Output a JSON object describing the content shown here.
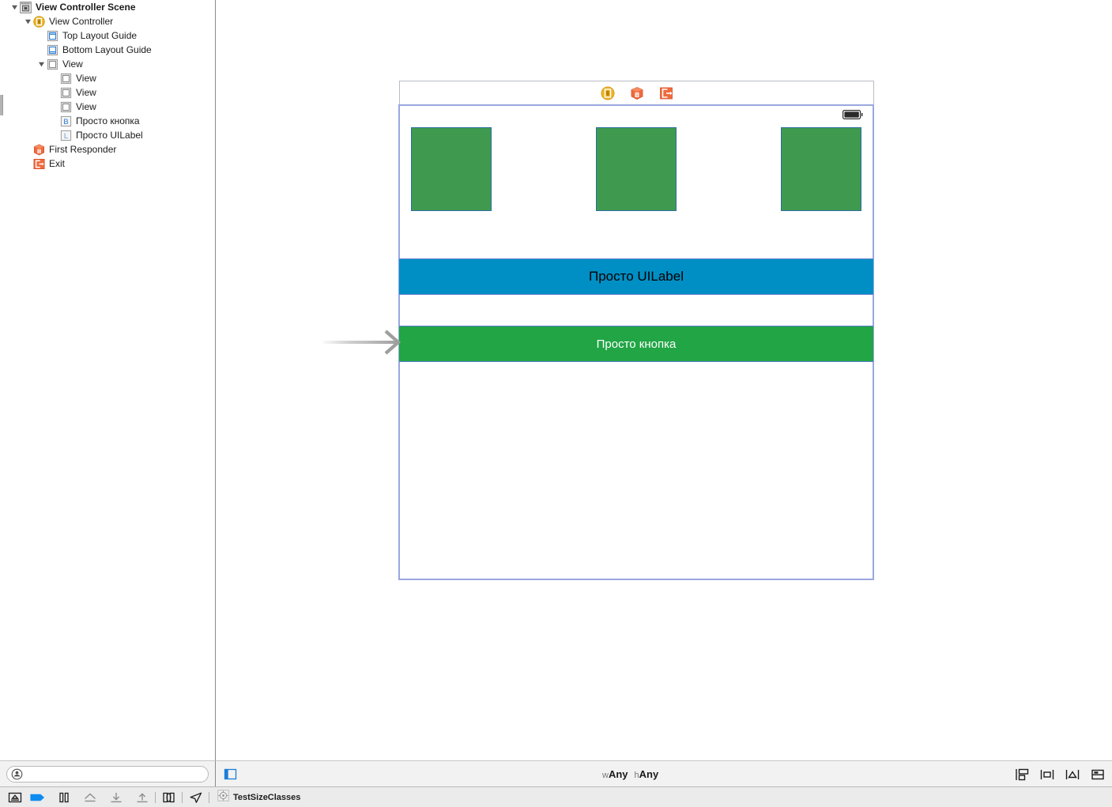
{
  "outline": {
    "panel_name": "Document Outline",
    "filter_placeholder": "",
    "filter_value": "",
    "rows": [
      {
        "label": "View Controller Scene",
        "icon": "scene-icon",
        "depth": 0,
        "expanded": true,
        "bold": true
      },
      {
        "label": "View Controller",
        "icon": "view-controller-icon",
        "depth": 1,
        "expanded": true,
        "bold": false
      },
      {
        "label": "Top Layout Guide",
        "icon": "top-layout-guide-icon",
        "depth": 2,
        "expanded": null,
        "bold": false
      },
      {
        "label": "Bottom Layout Guide",
        "icon": "bottom-layout-guide-icon",
        "depth": 2,
        "expanded": null,
        "bold": false
      },
      {
        "label": "View",
        "icon": "view-icon",
        "depth": 2,
        "expanded": true,
        "bold": false
      },
      {
        "label": "View",
        "icon": "view-icon",
        "depth": 3,
        "expanded": null,
        "bold": false
      },
      {
        "label": "View",
        "icon": "view-icon",
        "depth": 3,
        "expanded": null,
        "bold": false
      },
      {
        "label": "View",
        "icon": "view-icon",
        "depth": 3,
        "expanded": null,
        "bold": false
      },
      {
        "label": "Просто кнопка",
        "icon": "button-icon",
        "depth": 3,
        "expanded": null,
        "bold": false
      },
      {
        "label": "Просто UILabel",
        "icon": "label-icon",
        "depth": 3,
        "expanded": null,
        "bold": false
      },
      {
        "label": "First Responder",
        "icon": "first-responder-icon",
        "depth": 1,
        "expanded": null,
        "bold": false
      },
      {
        "label": "Exit",
        "icon": "exit-icon",
        "depth": 1,
        "expanded": null,
        "bold": false
      }
    ]
  },
  "canvas": {
    "scene_dock": [
      {
        "name": "view-controller-icon",
        "tooltip": "View Controller"
      },
      {
        "name": "first-responder-icon",
        "tooltip": "First Responder"
      },
      {
        "name": "exit-icon",
        "tooltip": "Exit"
      }
    ],
    "status_bar": {
      "battery_icon": "battery-icon"
    },
    "squares": [
      {
        "name": "green-square-1",
        "color": "#3f9a4f"
      },
      {
        "name": "green-square-2",
        "color": "#3f9a4f"
      },
      {
        "name": "green-square-3",
        "color": "#3f9a4f"
      }
    ],
    "label_band": {
      "text": "Просто UILabel",
      "background": "#008fc4",
      "text_color": "#000000"
    },
    "button_band": {
      "text": "Просто кнопка",
      "background": "#21a545",
      "text_color": "#ffffff"
    },
    "selection_border_color": "#9aa7e0"
  },
  "status_bar": {
    "doc_outline_toggle": "document-outline-toggle-icon",
    "size_class": {
      "width_prefix": "w",
      "width_value": "Any",
      "height_prefix": "h",
      "height_value": "Any"
    },
    "autolayout": [
      {
        "name": "stack-button",
        "label": "Stack"
      },
      {
        "name": "align-button",
        "label": "Align"
      },
      {
        "name": "pin-button",
        "label": "Pin"
      },
      {
        "name": "resolve-issues-button",
        "label": "Resolve Auto Layout Issues"
      }
    ]
  },
  "debug_bar": {
    "buttons": [
      {
        "name": "hide-debug-area-button",
        "label": "Hide Debug Area"
      },
      {
        "name": "activate-breakpoints-button",
        "label": "Activate Breakpoints"
      },
      {
        "name": "pause-button",
        "label": "Pause"
      },
      {
        "name": "step-over-button",
        "label": "Step Over"
      },
      {
        "name": "step-into-button",
        "label": "Step Into"
      },
      {
        "name": "step-out-button",
        "label": "Step Out"
      },
      {
        "name": "view-hierarchy-button",
        "label": "Debug View Hierarchy"
      },
      {
        "name": "simulate-location-button",
        "label": "Simulate Location"
      }
    ],
    "breadcrumb": {
      "icon": "target-icon",
      "label": "TestSizeClasses"
    }
  },
  "colors": {
    "green_square": "#3f9a4f",
    "label_blue": "#008fc4",
    "button_green": "#21a545",
    "selection_blue": "#9aa7e0",
    "accent_orange": "#f06a3c",
    "accent_yellow": "#f0b52a"
  }
}
